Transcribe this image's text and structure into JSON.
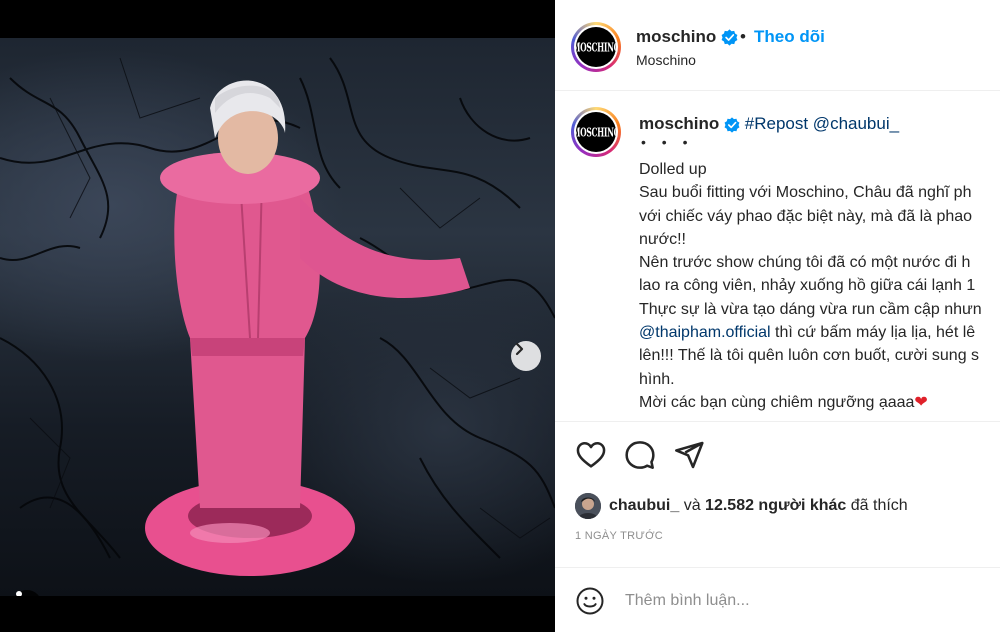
{
  "post": {
    "username": "moschino",
    "subtitle": "Moschino",
    "follow_label": "Theo dõi",
    "separator": "•",
    "avatar_text": "MOSCHINO"
  },
  "caption": {
    "username": "moschino",
    "repost": "#Repost @chaubui_",
    "dots": "• • •",
    "lines": [
      "Dolled up",
      "Sau buổi fitting với Moschino, Châu đã nghĩ ph",
      "với chiếc váy phao đặc biệt này, mà đã là phao",
      "nước!!",
      "Nên trước show chúng tôi đã có một nước đi h",
      "lao ra công viên, nhảy xuống hồ giữa cái lạnh 1",
      "Thực sự là vừa tạo dáng vừa run cầm cập nhưn",
      "thì cứ bấm máy lịa lịa, hét lê",
      "lên!!! Thế là tôi quên luôn cơn buốt, cười sung s",
      "hình.",
      "Mời các bạn cùng chiêm ngưỡng ạaaa"
    ],
    "mention": "@thaipham.official",
    "heart": "❤"
  },
  "likes": {
    "user": "chaubui_",
    "connector": "và",
    "count_text": "12.582 người khác",
    "suffix": "đã thích"
  },
  "timestamp": "1 NGÀY TRƯỚC",
  "comment": {
    "placeholder": "Thêm bình luận..."
  },
  "carousel": {
    "total": 4,
    "active_index": 0
  },
  "colors": {
    "accent": "#0095f6",
    "mention": "#00376b",
    "text": "#262626",
    "muted": "#8e8e8e"
  }
}
